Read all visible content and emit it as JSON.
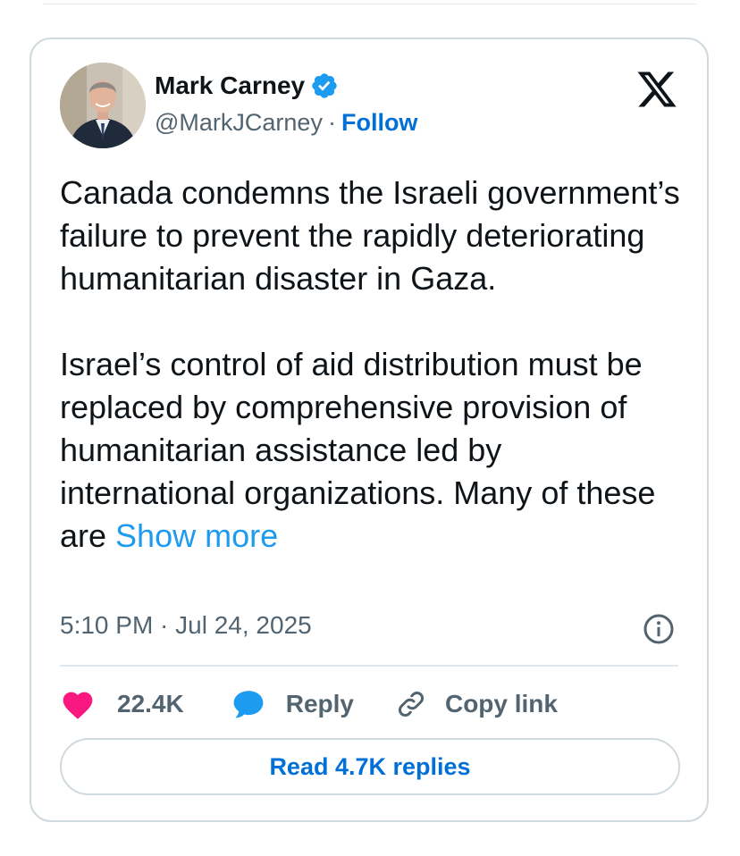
{
  "tweet": {
    "author": {
      "name": "Mark Carney",
      "handle": "@MarkJCarney",
      "verified": true,
      "avatar_icon": "profile-photo"
    },
    "follow_label": "Follow",
    "separator": "·",
    "paragraphs": [
      "Canada condemns the Israeli government’s failure to prevent the rapidly deteriorating humanitarian disaster in Gaza.",
      "Israel’s control of aid distribution must be replaced by comprehensive provision of humanitarian assistance led by international organizations. Many of these are "
    ],
    "show_more_label": "Show more",
    "timestamp": "5:10 PM · Jul 24, 2025",
    "platform_icon": "x-logo-icon",
    "actions": {
      "likes": "22.4K",
      "reply_label": "Reply",
      "copy_link_label": "Copy link"
    },
    "read_replies_label": "Read 4.7K replies"
  },
  "colors": {
    "link": "#006fd6",
    "show_more": "#1d9bf0",
    "like": "#f91880",
    "reply": "#1d9bf0",
    "secondary_text": "#536471",
    "border": "#cfd9de"
  }
}
